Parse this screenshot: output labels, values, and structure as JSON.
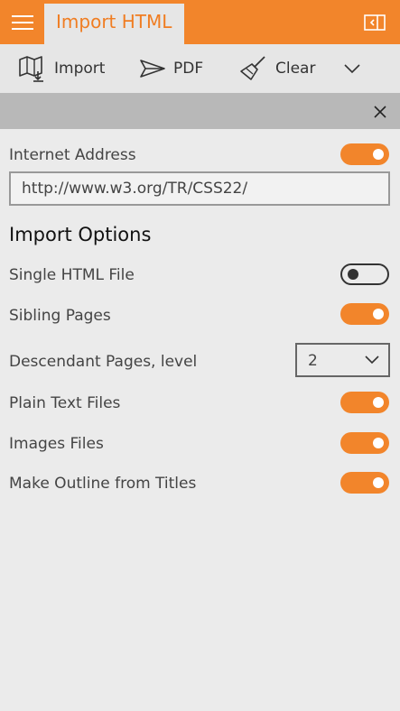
{
  "app": {
    "tab_title": "Import HTML"
  },
  "icons": {
    "menu": "hamburger-menu-icon",
    "panel": "panel-toggle-icon",
    "import": "map-import-icon",
    "pdf": "paper-plane-icon",
    "clear": "broom-icon",
    "more": "chevron-down-icon",
    "close": "close-icon"
  },
  "toolbar": {
    "import_label": "Import",
    "pdf_label": "PDF",
    "clear_label": "Clear"
  },
  "form": {
    "internet_address_label": "Internet Address",
    "internet_address_enabled": true,
    "url_value": "http://www.w3.org/TR/CSS22/",
    "import_options_title": "Import Options",
    "options": [
      {
        "label": "Single HTML File",
        "enabled": false
      },
      {
        "label": "Sibling Pages",
        "enabled": true
      },
      {
        "label": "Descendant Pages, level",
        "value": "2"
      },
      {
        "label": "Plain Text Files",
        "enabled": true
      },
      {
        "label": "Images Files",
        "enabled": true
      },
      {
        "label": "Make Outline from Titles",
        "enabled": true
      }
    ]
  },
  "colors": {
    "accent": "#f2852b",
    "accent_text": "#f07d22",
    "subbar": "#b8b8b8",
    "background": "#ebebeb"
  }
}
